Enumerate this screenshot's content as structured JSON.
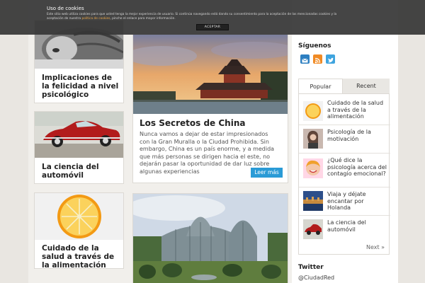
{
  "cookie_bar": {
    "title": "Uso de cookies",
    "text_before_link": "Este sitio web utiliza cookies para que usted tenga la mejor experiencia de usuario. Si continúa navegando está dando su consentimiento para la aceptación de las mencionadas cookies y la aceptación de nuestra",
    "link_text": "política de cookies",
    "text_after_link": ", pinche el enlace para mayor información.",
    "accept_label": "ACEPTAR"
  },
  "posts": {
    "felicidad": {
      "title": "Implicaciones de la felicidad a nivel psicológico"
    },
    "automovil": {
      "title": "La ciencia del automóvil"
    },
    "naranja": {
      "title": "Cuidado de la salud a través de la alimentación"
    },
    "china": {
      "title": "Los Secretos de China",
      "excerpt": "Nunca vamos a dejar de estar impresionados con la Gran Muralla o la Ciudad Prohibida. Sin embargo, China es un país enorme, y a medida que más personas se dirigen hacia el este, no dejarán pasar la oportunidad de dar luz sobre algunas experiencias",
      "more_label": "Leer más"
    }
  },
  "sidebar": {
    "follow_title": "Síguenos",
    "social_icons": [
      "email-icon",
      "rss-icon",
      "twitter-icon"
    ],
    "tabs": [
      {
        "label": "Popular"
      },
      {
        "label": "Recent"
      }
    ],
    "items": [
      {
        "title": "Cuidado de la salud a través de la alimentación"
      },
      {
        "title": "Psicología de la motivación"
      },
      {
        "title": "¿Qué dice la psicología acerca del contagio emocional?"
      },
      {
        "title": "Viaja y déjate encantar por Holanda"
      },
      {
        "title": "La ciencia del automóvil"
      }
    ],
    "next_label": "Next »",
    "twitter_title": "Twitter",
    "twitter_handle": "@CiudadRed"
  },
  "colors": {
    "accent": "#2a9bd6",
    "cookie_link": "#e9a74a"
  }
}
